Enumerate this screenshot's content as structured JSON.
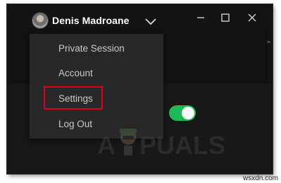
{
  "header": {
    "username": "Denis Madroane"
  },
  "window_controls": {
    "minimize": "minimize",
    "maximize": "maximize",
    "close": "close"
  },
  "menu": {
    "items": [
      {
        "label": "Private Session"
      },
      {
        "label": "Account"
      },
      {
        "label": "Settings",
        "highlighted": true
      },
      {
        "label": "Log Out"
      }
    ]
  },
  "toggle": {
    "state": "on",
    "color": "#1db954"
  },
  "watermark": {
    "text_left": "A",
    "text_right": "PUALS"
  },
  "credit": "wsxdn.com",
  "colors": {
    "highlight_border": "#e2001a",
    "menu_bg": "#282828",
    "window_bg": "#181818"
  }
}
